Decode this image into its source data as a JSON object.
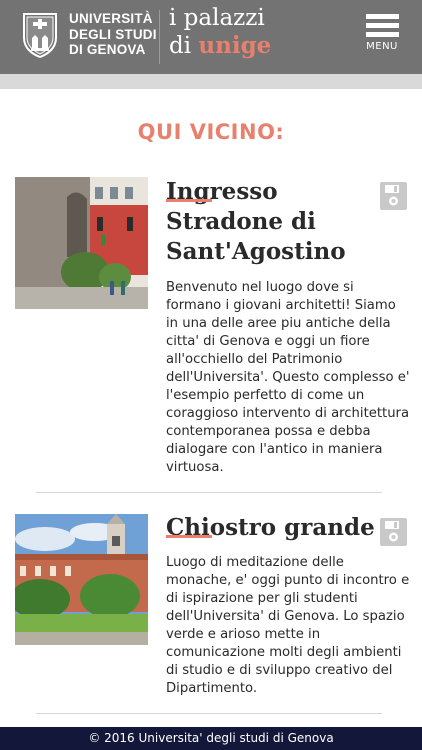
{
  "header": {
    "university_lines": [
      "UNIVERSITÀ",
      "DEGLI STUDI",
      "DI GENOVA"
    ],
    "brand_line1": "i palazzi",
    "brand_di": "di",
    "brand_unige": "unige",
    "menu_label": "MENU"
  },
  "section_title": "QUI VICINO:",
  "places": [
    {
      "title_first": "Ingresso",
      "title_rest": "Stradone di Sant'Agostino",
      "description": "Benvenuto nel luogo dove si formano i giovani architetti! Siamo in una delle aree piu antiche della citta' di Genova e oggi un fiore all'occhiello del Patrimonio dell'Universita'. Questo complesso e' l'esempio perfetto di come un coraggioso intervento di architettura contemporanea possa e debba dialogare con l'antico in maniera virtuosa.",
      "save_icon": "floppy-disk-icon"
    },
    {
      "title_first": "Chiostro",
      "title_rest": "grande",
      "description": "Luogo di meditazione delle monache, e' oggi punto di incontro e di ispirazione per gli studenti dell'Universita' di Genova. Lo spazio verde e arioso mette in comunicazione molti degli ambienti di studio e di sviluppo creativo del Dipartimento.",
      "save_icon": "floppy-disk-icon"
    }
  ],
  "footer": "© 2016 Universita' degli studi di Genova",
  "colors": {
    "header_bg": "#737373",
    "accent": "#e8806d",
    "footer_bg": "#13183a",
    "subbar": "#d9d9d9"
  }
}
